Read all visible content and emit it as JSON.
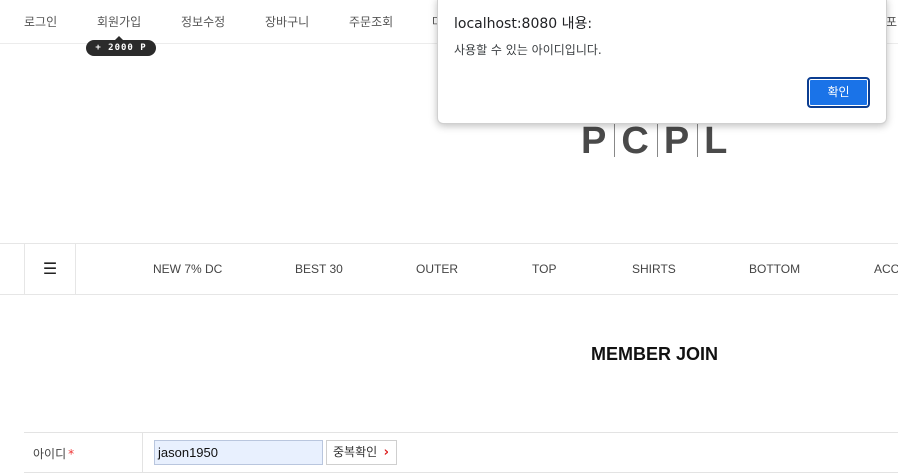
{
  "top_bar": {
    "links": [
      "로그인",
      "회원가입",
      "정보수정",
      "장바구니",
      "주문조회",
      "마",
      "포"
    ],
    "points_badge": "+ 2000 P"
  },
  "logo": {
    "letters": [
      "P",
      "C",
      "P",
      "L"
    ]
  },
  "category_nav": {
    "menu_icon": "☰",
    "items": [
      "NEW 7% DC",
      "BEST 30",
      "OUTER",
      "TOP",
      "SHIRTS",
      "BOTTOM",
      "ACC"
    ]
  },
  "page_title": "MEMBER JOIN",
  "form": {
    "id_label": "아이디",
    "required_mark": "*",
    "id_value": "jason1950",
    "dup_check_label": "중복확인",
    "dup_check_chevron": "›"
  },
  "dialog": {
    "title": "localhost:8080 내용:",
    "message": "사용할 수 있는 아이디입니다.",
    "ok_label": "확인"
  },
  "colors": {
    "dialog_button": "#1a73e8",
    "required": "#e33333",
    "badge": "#2b2b2b",
    "input_autofill": "#e8f0fe"
  }
}
